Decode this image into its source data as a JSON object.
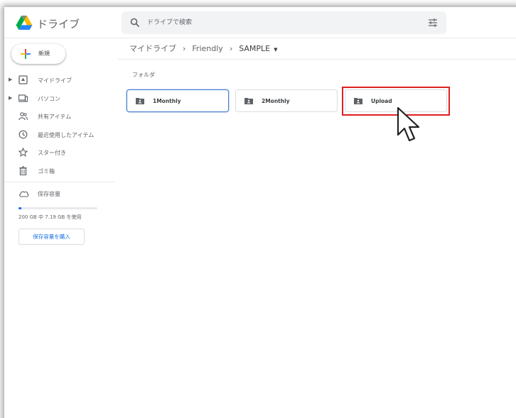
{
  "header": {
    "app_name": "ドライブ",
    "search_placeholder": "ドライブで検索"
  },
  "sidebar": {
    "new_label": "新規",
    "items": [
      {
        "label": "マイドライブ",
        "icon": "my-drive-icon",
        "expandable": true
      },
      {
        "label": "パソコン",
        "icon": "computers-icon",
        "expandable": true
      },
      {
        "label": "共有アイテム",
        "icon": "shared-icon",
        "expandable": false
      },
      {
        "label": "最近使用したアイテム",
        "icon": "recent-icon",
        "expandable": false
      },
      {
        "label": "スター付き",
        "icon": "star-icon",
        "expandable": false
      },
      {
        "label": "ゴミ箱",
        "icon": "trash-icon",
        "expandable": false
      }
    ],
    "storage": {
      "label": "保存容量",
      "usage_text": "200 GB 中 7.19 GB を使用",
      "used_fraction": 0.036,
      "buy_label": "保存容量を購入"
    }
  },
  "breadcrumb": [
    "マイドライブ",
    "Friendly",
    "SAMPLE"
  ],
  "main": {
    "section_label": "フォルダ",
    "folders": [
      {
        "name": "1Monthly",
        "selected": true
      },
      {
        "name": "2Monthly",
        "selected": false
      },
      {
        "name": "Upload",
        "selected": false,
        "highlighted": true
      }
    ]
  },
  "colors": {
    "accent": "#1a73e8",
    "highlight": "#e02020",
    "selected_border": "#4a7fd0"
  }
}
